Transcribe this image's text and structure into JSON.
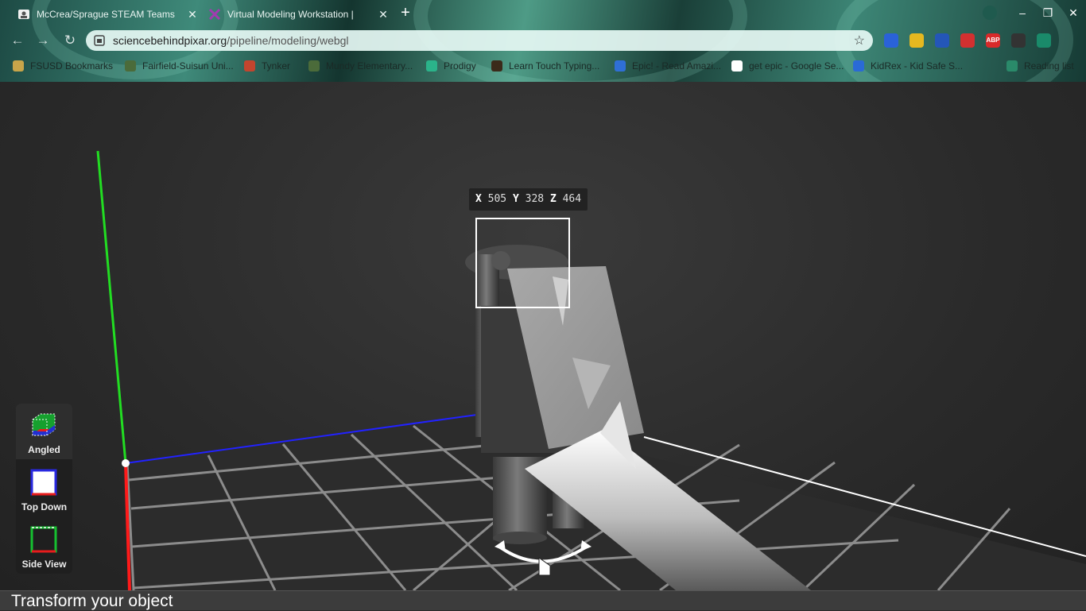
{
  "browser": {
    "tabs": [
      {
        "title": "McCrea/Sprague STEAM Teams",
        "active": true
      },
      {
        "title": "Virtual Modeling Workstation |",
        "active": false
      }
    ],
    "url_host": "sciencebehindpixar.org",
    "url_path": "/pipeline/modeling/webgl",
    "bookmarks": [
      {
        "label": "FSUSD Bookmarks",
        "icon": "folder-icon"
      },
      {
        "label": "Fairfield-Suisun Uni...",
        "icon": "shield-icon"
      },
      {
        "label": "Tynker",
        "icon": "tynker-icon"
      },
      {
        "label": "Mundy Elementary...",
        "icon": "shield-icon"
      },
      {
        "label": "Prodigy",
        "icon": "prodigy-icon"
      },
      {
        "label": "Learn Touch Typing...",
        "icon": "typing-icon"
      },
      {
        "label": "Epic! - Read Amazi...",
        "icon": "epic-icon"
      },
      {
        "label": "get epic - Google Se...",
        "icon": "google-icon"
      },
      {
        "label": "KidRex - Kid Safe S...",
        "icon": "kidrex-icon"
      },
      {
        "label": "Reading list",
        "icon": "reading-list-icon"
      }
    ],
    "extensions": [
      {
        "name": "shield-ext-icon",
        "color": "#2a62d8"
      },
      {
        "name": "pencil-ext-icon",
        "color": "#e6b820"
      },
      {
        "name": "diamond-ext-icon",
        "color": "#2456b8"
      },
      {
        "name": "video-ext-icon",
        "color": "#d23030"
      },
      {
        "name": "abp-ext-icon",
        "color": "#d82a2a",
        "text": "ABP"
      },
      {
        "name": "spy-ext-icon",
        "color": "#333333"
      },
      {
        "name": "puzzle-ext-icon",
        "color": "#1a8a6a"
      }
    ]
  },
  "coords": {
    "x_label": "X",
    "x": "505",
    "y_label": "Y",
    "y": "328",
    "z_label": "Z",
    "z": "464"
  },
  "views": [
    {
      "label": "Angled",
      "selected": true
    },
    {
      "label": "Top Down",
      "selected": false
    },
    {
      "label": "Side View",
      "selected": false
    }
  ],
  "footer": {
    "text": "Transform your object"
  },
  "colors": {
    "x_axis": "#ff1a1a",
    "y_axis": "#22dd22",
    "z_axis": "#2222ff"
  }
}
